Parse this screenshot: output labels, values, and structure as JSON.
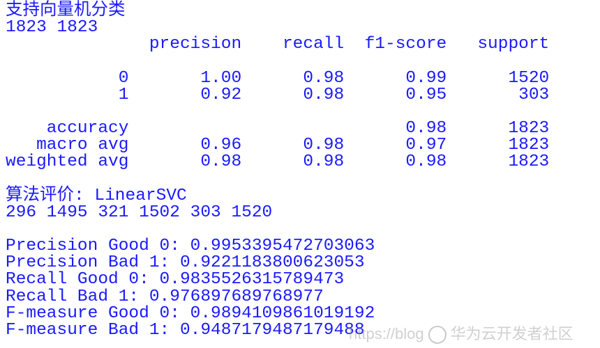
{
  "colors": {
    "text": "#1a1aff",
    "background": "#ffffff"
  },
  "header_lines": [
    "支持向量机分类",
    "1823 1823"
  ],
  "report": {
    "columns": [
      "precision",
      "recall",
      "f1-score",
      "support"
    ],
    "rows": [
      {
        "label": "0",
        "precision": "1.00",
        "recall": "0.98",
        "f1": "0.99",
        "support": "1520"
      },
      {
        "label": "1",
        "precision": "0.92",
        "recall": "0.98",
        "f1": "0.95",
        "support": "303"
      }
    ],
    "summary": [
      {
        "label": "accuracy",
        "precision": "",
        "recall": "",
        "f1": "0.98",
        "support": "1823"
      },
      {
        "label": "macro avg",
        "precision": "0.96",
        "recall": "0.98",
        "f1": "0.97",
        "support": "1823"
      },
      {
        "label": "weighted avg",
        "precision": "0.98",
        "recall": "0.98",
        "f1": "0.98",
        "support": "1823"
      }
    ]
  },
  "evaluation": {
    "title": "算法评价: LinearSVC",
    "counts": "296 1495 321 1502 303 1520",
    "metrics": [
      "Precision Good 0: 0.9953395472703063",
      "Precision Bad 1: 0.9221183800623053",
      "Recall Good 0: 0.9835526315789473",
      "Recall Bad 1: 0.976897689768977",
      "F-measure Good 0: 0.9894109861019192",
      "F-measure Bad 1: 0.9487179487179488"
    ]
  },
  "watermark": {
    "url": "https://blog",
    "brand": "华为云开发者社区"
  }
}
